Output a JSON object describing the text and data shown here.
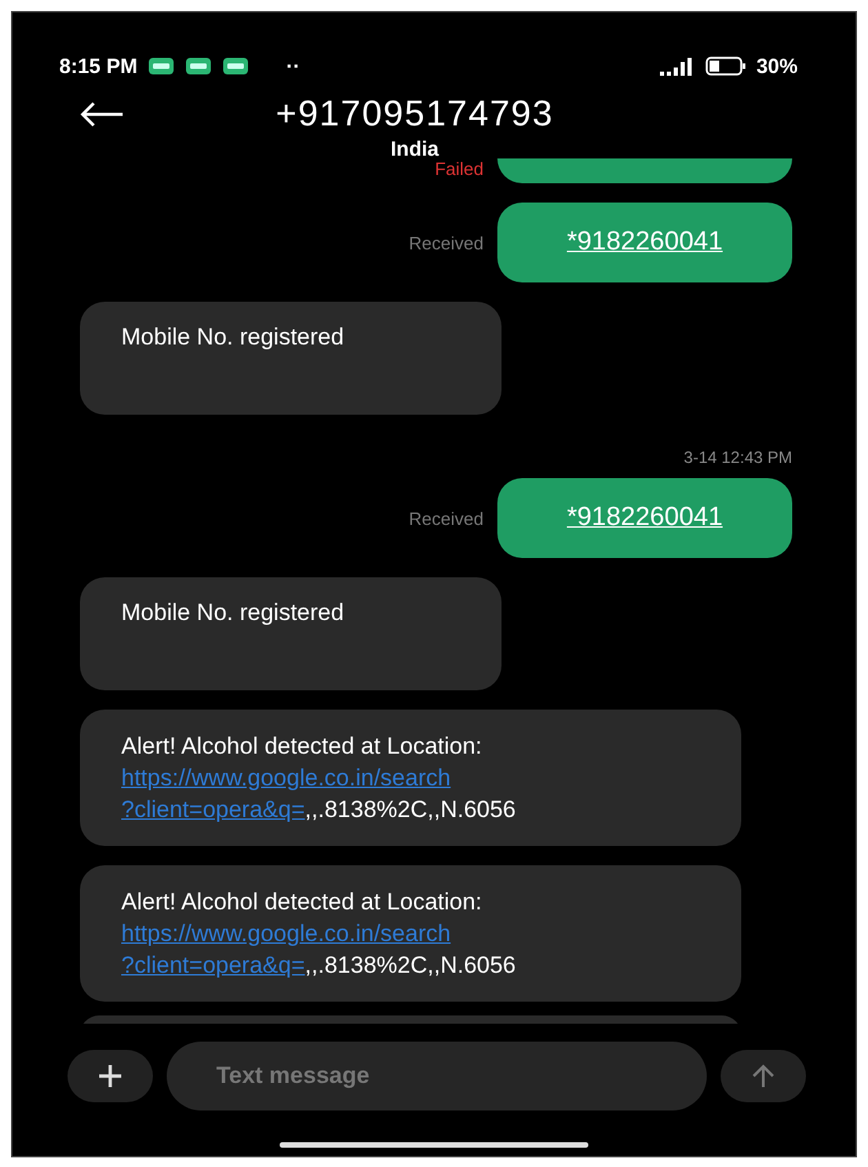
{
  "status_bar": {
    "time": "8:15 PM",
    "more": "··",
    "battery": "30%"
  },
  "header": {
    "title": "+917095174793",
    "subtitle": "India"
  },
  "messages": [
    {
      "kind": "sent-partial",
      "status": "Failed",
      "failed": true
    },
    {
      "kind": "sent",
      "status": "Received",
      "failed": false,
      "text": "*9182260041"
    },
    {
      "kind": "received",
      "text": "Mobile No. registered"
    },
    {
      "kind": "timestamp",
      "text": "3-14 12:43 PM"
    },
    {
      "kind": "sent",
      "status": "Received",
      "failed": false,
      "text": "*9182260041"
    },
    {
      "kind": "received",
      "text": "Mobile No. registered"
    },
    {
      "kind": "alert",
      "text": "Alert! Alcohol detected at Location:",
      "link_lines": [
        "https://www.google.co.in/search",
        "?client=opera&q="
      ],
      "tail": ",,.8138%2C,,N.6056"
    },
    {
      "kind": "alert",
      "text": "Alert! Alcohol detected at Location:",
      "link_lines": [
        "https://www.google.co.in/search",
        "?client=opera&q="
      ],
      "tail": ",,.8138%2C,,N.6056"
    },
    {
      "kind": "received-partial"
    }
  ],
  "composer": {
    "placeholder": "Text message"
  }
}
